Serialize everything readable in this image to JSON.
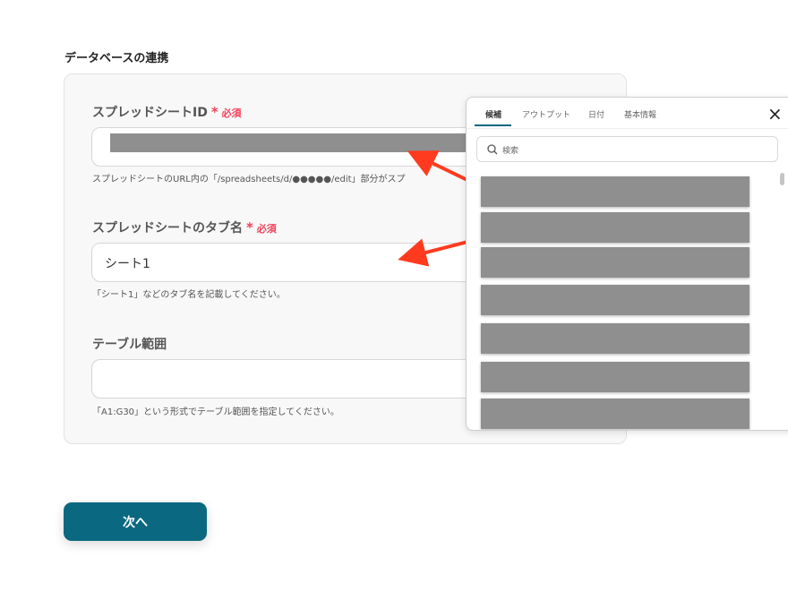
{
  "section_title": "データベースの連携",
  "fields": [
    {
      "label": "スプレッドシートID",
      "required": "必須",
      "value": "",
      "hint": "スプレッドシートのURL内の「/spreadsheets/d/●●●●●/edit」部分がスプ"
    },
    {
      "label": "スプレッドシートのタブ名",
      "required": "必須",
      "value": "シート1",
      "hint": "「シート1」などのタブ名を記載してください。"
    },
    {
      "label": "テーブル範囲",
      "value": "",
      "hint": "「A1:G30」という形式でテーブル範囲を指定してください。"
    }
  ],
  "required_mark": "*",
  "panel": {
    "tabs": [
      "候補",
      "アウトプット",
      "日付",
      "基本情報"
    ],
    "active_tab": 0,
    "close": "×",
    "search_placeholder": "検索",
    "items_count_visible": 7
  },
  "next_button": "次へ",
  "colors": {
    "accent": "#0a6880",
    "required": "#f0425a",
    "arrow": "#ff3b1f"
  }
}
